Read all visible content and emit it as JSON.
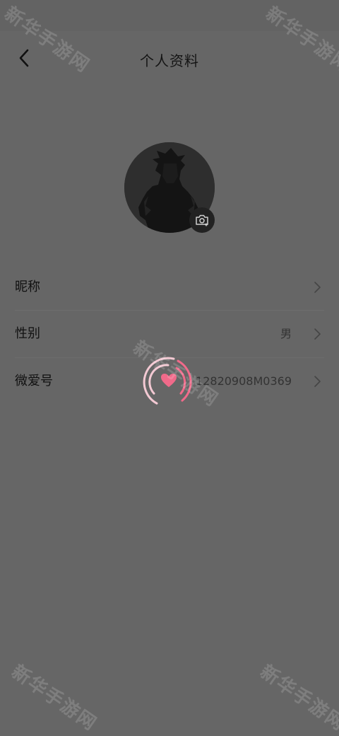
{
  "header": {
    "title": "个人资料",
    "back_icon": "chevron-left-icon"
  },
  "avatar": {
    "camera_icon": "camera-icon"
  },
  "profile_rows": [
    {
      "label": "昵称",
      "value": ""
    },
    {
      "label": "性别",
      "value": "男"
    },
    {
      "label": "微爱号",
      "value": "12820908M0369"
    }
  ],
  "loading": {
    "icon": "heart-spinner-icon",
    "accent": "#f06a8a"
  },
  "watermark": {
    "text": "新华手游网"
  },
  "colors": {
    "background": "#666666",
    "text_primary": "#111111",
    "accent": "#f06a8a"
  }
}
